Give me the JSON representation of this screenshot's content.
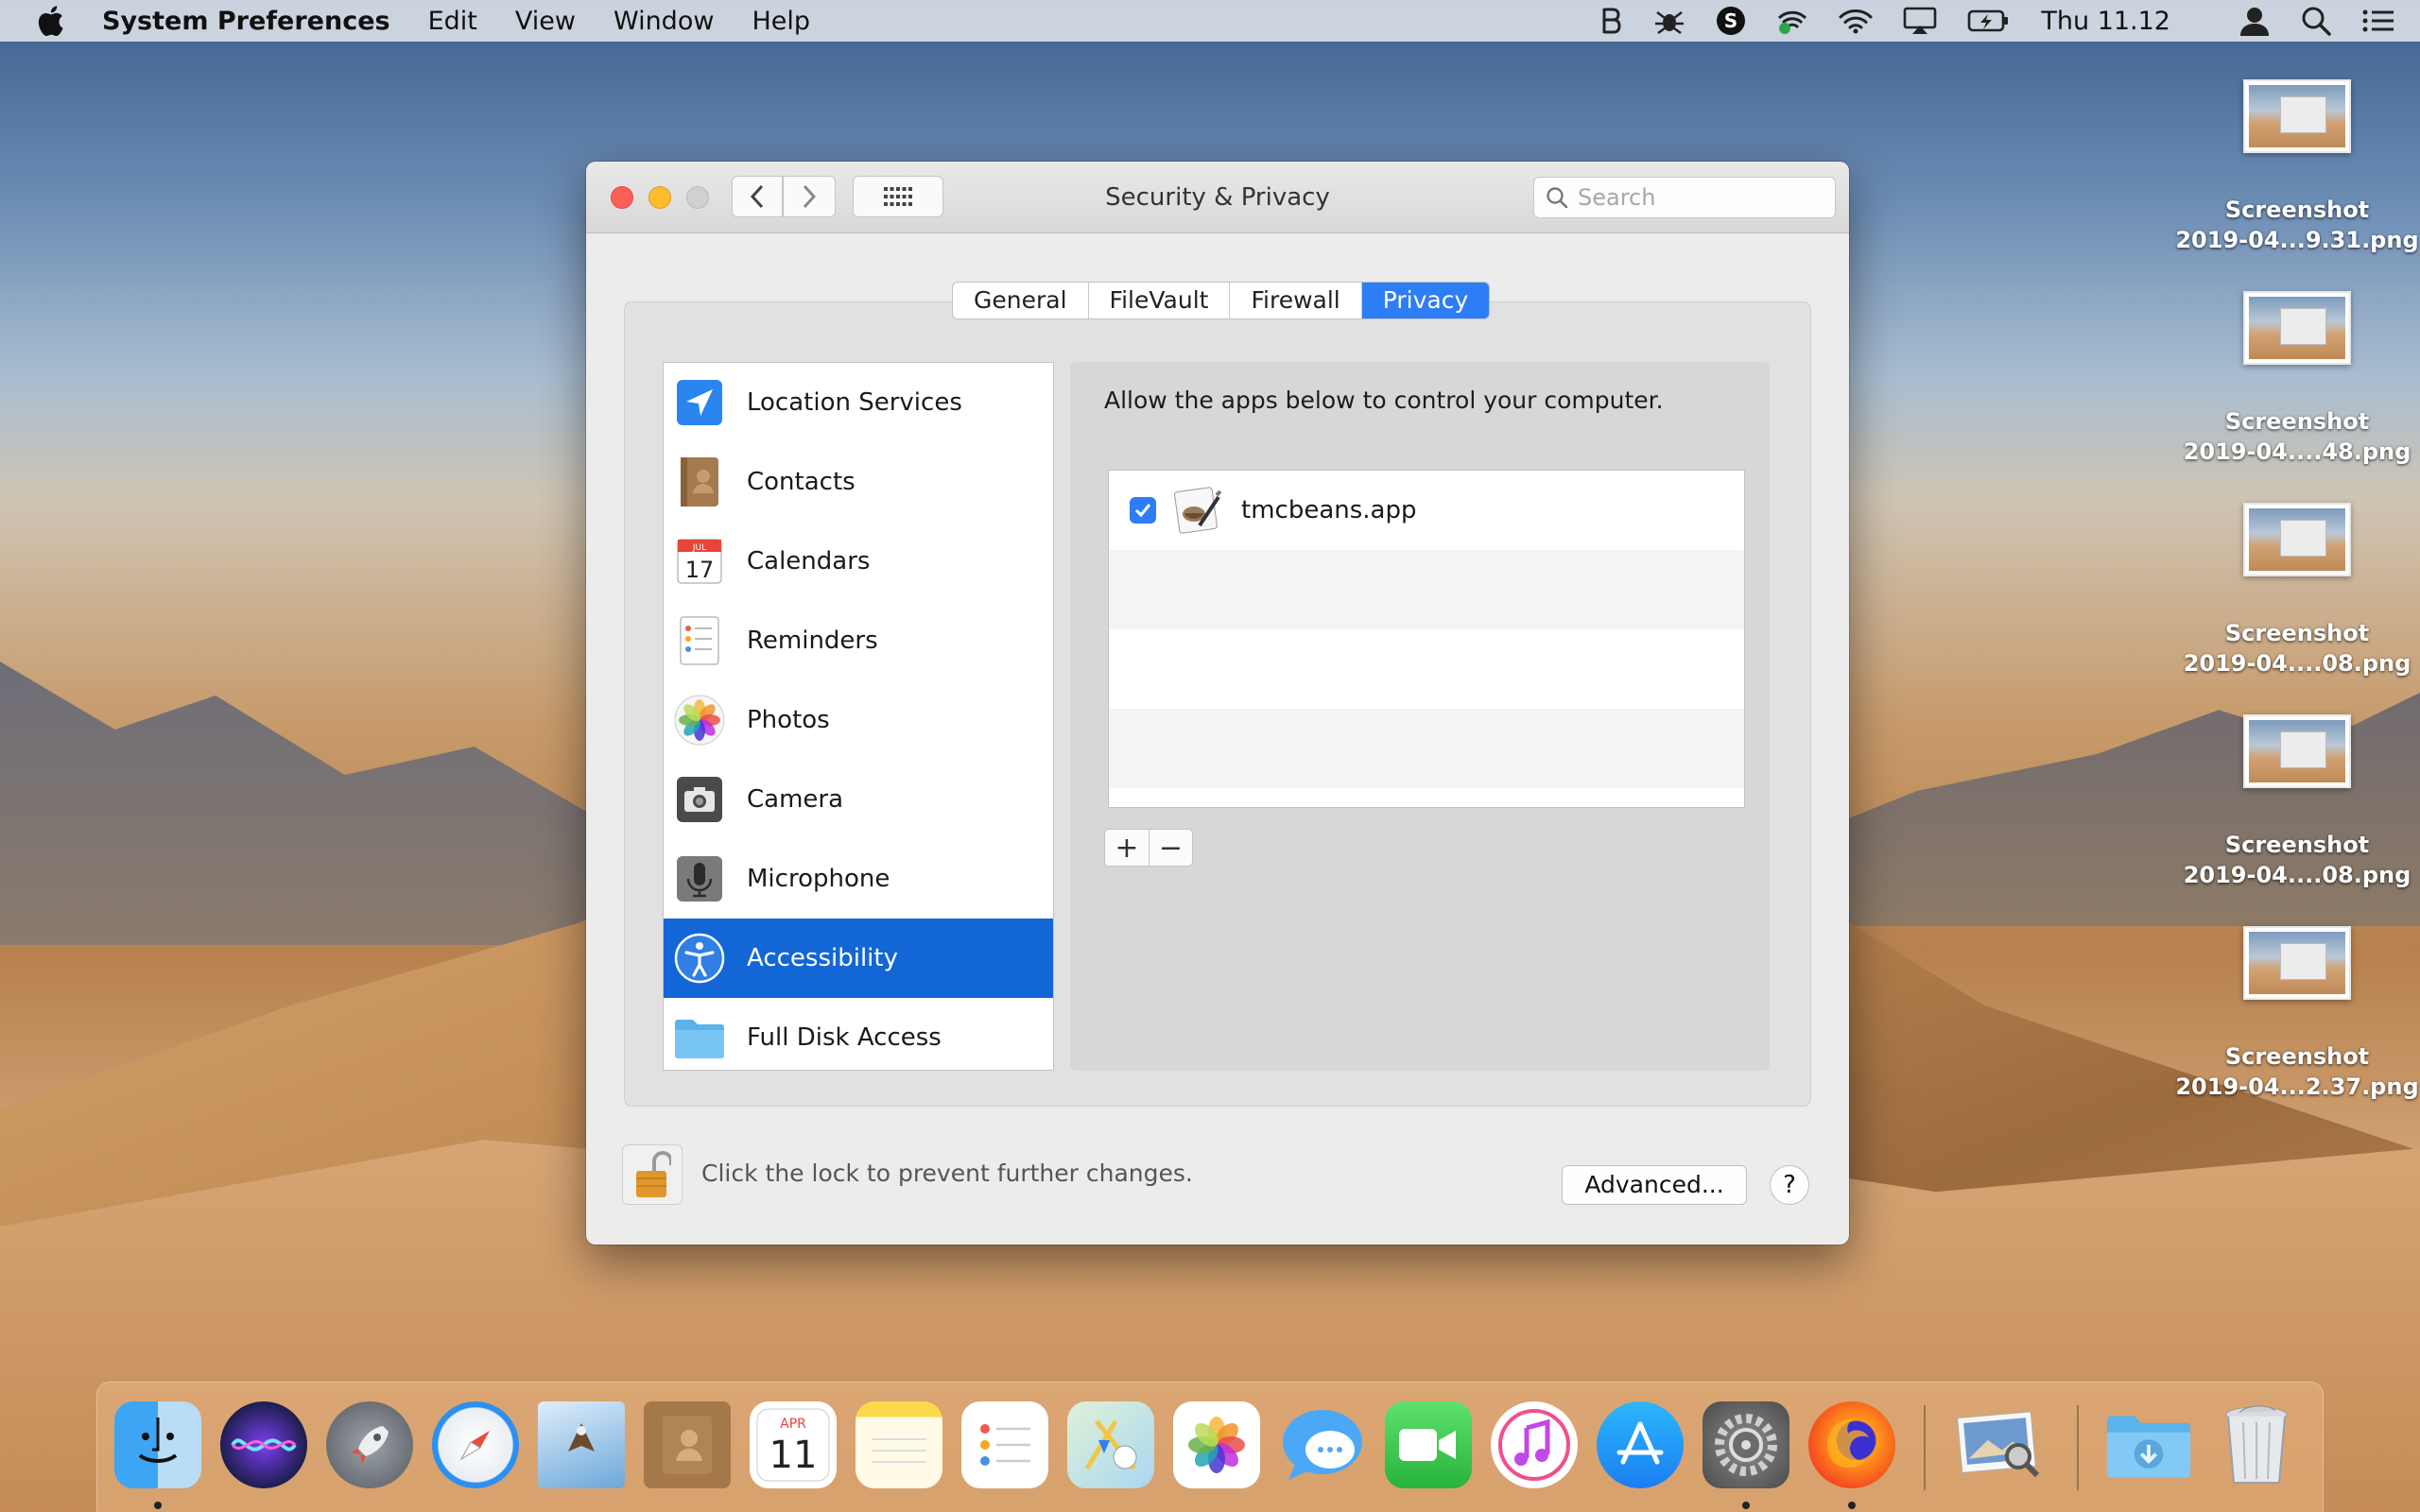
{
  "menubar": {
    "app_name": "System Preferences",
    "menus": [
      "Edit",
      "View",
      "Window",
      "Help"
    ],
    "clock": "Thu 11.12"
  },
  "window": {
    "title": "Security & Privacy",
    "search_placeholder": "Search",
    "tabs": [
      {
        "label": "General",
        "active": false
      },
      {
        "label": "FileVault",
        "active": false
      },
      {
        "label": "Firewall",
        "active": false
      },
      {
        "label": "Privacy",
        "active": true
      }
    ],
    "sidebar": {
      "items": [
        {
          "label": "Location Services",
          "icon": "location-arrow-icon"
        },
        {
          "label": "Contacts",
          "icon": "contacts-book-icon"
        },
        {
          "label": "Calendars",
          "icon": "calendar-icon"
        },
        {
          "label": "Reminders",
          "icon": "reminders-icon"
        },
        {
          "label": "Photos",
          "icon": "photos-flower-icon"
        },
        {
          "label": "Camera",
          "icon": "camera-icon"
        },
        {
          "label": "Microphone",
          "icon": "microphone-icon"
        },
        {
          "label": "Accessibility",
          "icon": "accessibility-icon",
          "selected": true
        },
        {
          "label": "Full Disk Access",
          "icon": "folder-icon"
        }
      ]
    },
    "panel": {
      "description": "Allow the apps below to control your computer.",
      "apps": [
        {
          "name": "tmcbeans.app",
          "checked": true
        }
      ],
      "add_label": "+",
      "remove_label": "−"
    },
    "calendar_icon_day": "17",
    "calendar_icon_month": "JUL",
    "footer": {
      "lock_text": "Click the lock to prevent further changes.",
      "advanced_label": "Advanced...",
      "help_label": "?"
    }
  },
  "desktop_icons": [
    {
      "line1": "Screenshot",
      "line2": "2019-04...9.31.png"
    },
    {
      "line1": "Screenshot",
      "line2": "2019-04....48.png"
    },
    {
      "line1": "Screenshot",
      "line2": "2019-04....08.png"
    },
    {
      "line1": "Screenshot",
      "line2": "2019-04....08.png"
    },
    {
      "line1": "Screenshot",
      "line2": "2019-04...2.37.png"
    }
  ],
  "dock": {
    "calendar_month": "APR",
    "calendar_day": "11"
  },
  "colors": {
    "accent": "#2d7df6",
    "selection": "#1366d6",
    "close": "#fc5f57",
    "minimize": "#fdbc2e"
  }
}
